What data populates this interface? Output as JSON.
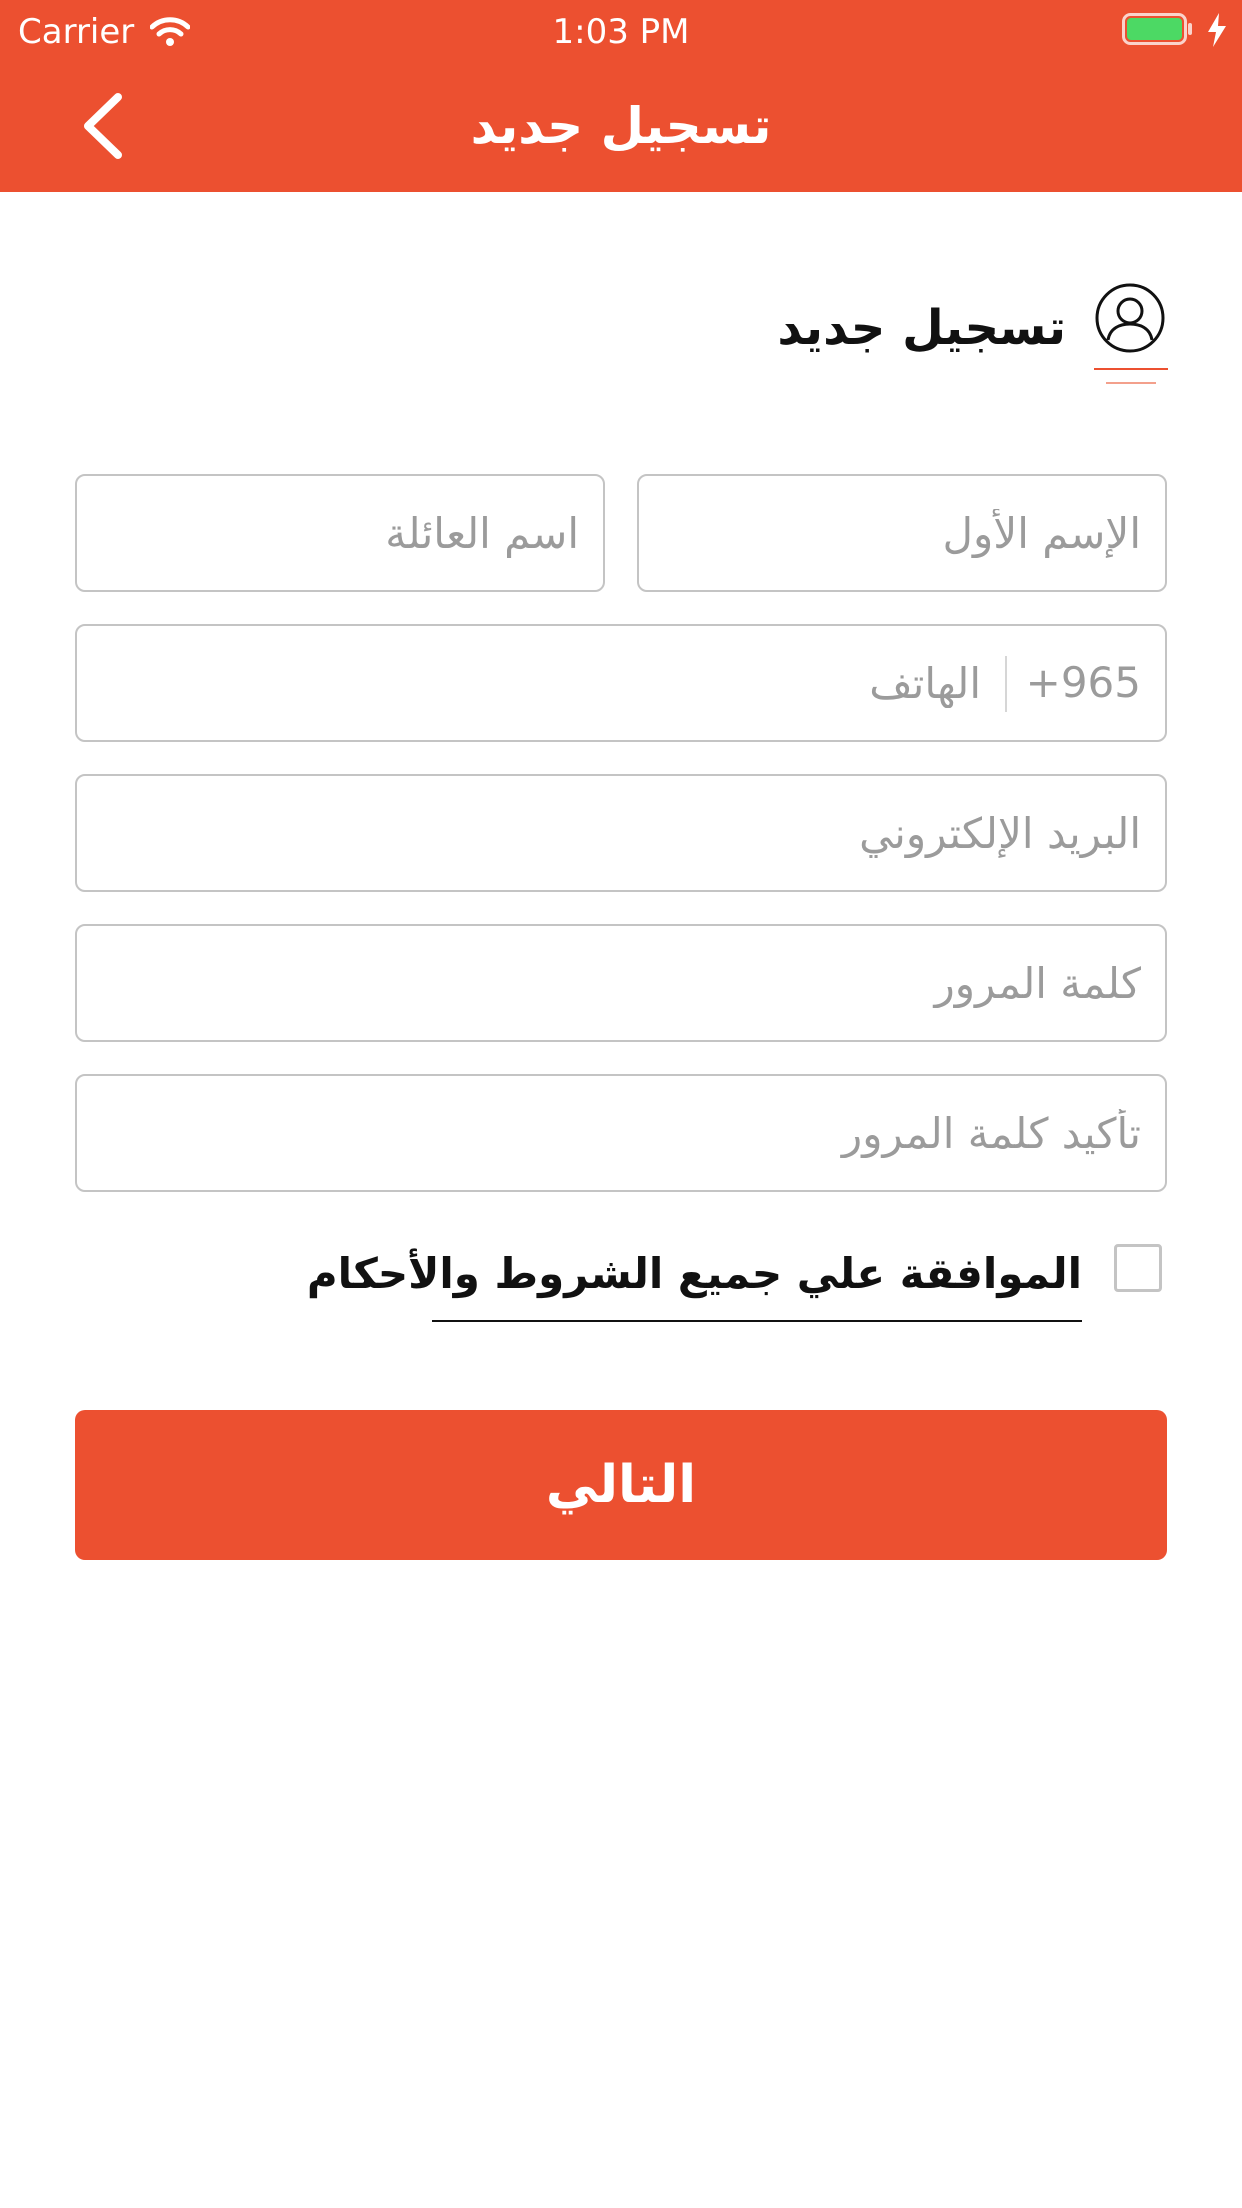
{
  "status_bar": {
    "carrier": "Carrier",
    "time": "1:03 PM"
  },
  "nav": {
    "title": "تسجيل جديد",
    "back_icon": "chevron-left-icon"
  },
  "section": {
    "title": "تسجيل جديد",
    "icon": "user-icon"
  },
  "form": {
    "first_name_placeholder": "الإسم الأول",
    "last_name_placeholder": "اسم العائلة",
    "phone_prefix": "+965",
    "phone_placeholder": "الهاتف",
    "email_placeholder": "البريد الإلكتروني",
    "password_placeholder": "كلمة المرور",
    "confirm_password_placeholder": "تأكيد كلمة المرور"
  },
  "terms": {
    "label": "الموافقة علي جميع الشروط والأحكام",
    "checked": false
  },
  "next_button": {
    "label": "التالي"
  },
  "colors": {
    "accent": "#EC5030",
    "field_border": "#C4C4C4",
    "placeholder": "#9B9B9B",
    "battery_fill": "#4CD964"
  }
}
